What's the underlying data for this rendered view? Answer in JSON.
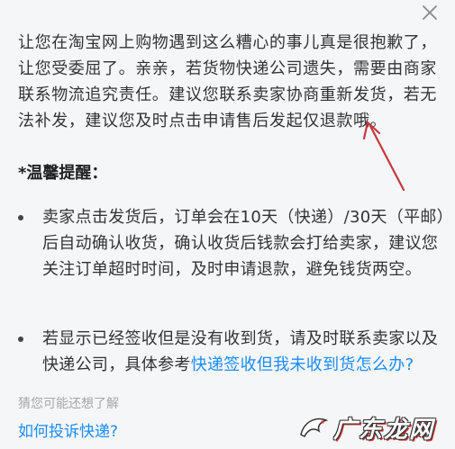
{
  "main": {
    "paragraph": "让您在淘宝网上购物遇到这么糟心的事儿真是很抱歉了，让您受委屈了。亲亲，若货物快递公司遗失，需要由商家联系物流追究责任。建议您联系卖家协商重新发货，若无法补发，建议您及时点击申请售后发起仅退款哦。",
    "tips_title": "*温馨提醒：",
    "bullet1": "卖家点击发货后，订单会在10天（快递）/30天（平邮）后自动确认收货，确认收货后钱款会打给卖家，建议您关注订单超时时间，及时申请退款，避免钱货两空。",
    "bullet2_text": "若显示已经签收但是没有收到货，请及时联系卖家以及快递公司，具体参考",
    "bullet2_link": "快递签收但我未收到货怎么办?"
  },
  "footer": {
    "guess_label": "猜您可能还想了解",
    "question_link": "如何投诉快递?"
  },
  "watermark": {
    "text": "广东龙网"
  },
  "colors": {
    "link": "#1a8cff",
    "arrow": "#c8363c",
    "background": "#f5f6f8"
  },
  "icons": {
    "close": "close-icon",
    "arrow": "arrow-annotation-icon",
    "watermark_logo": "dragon-logo-icon"
  }
}
